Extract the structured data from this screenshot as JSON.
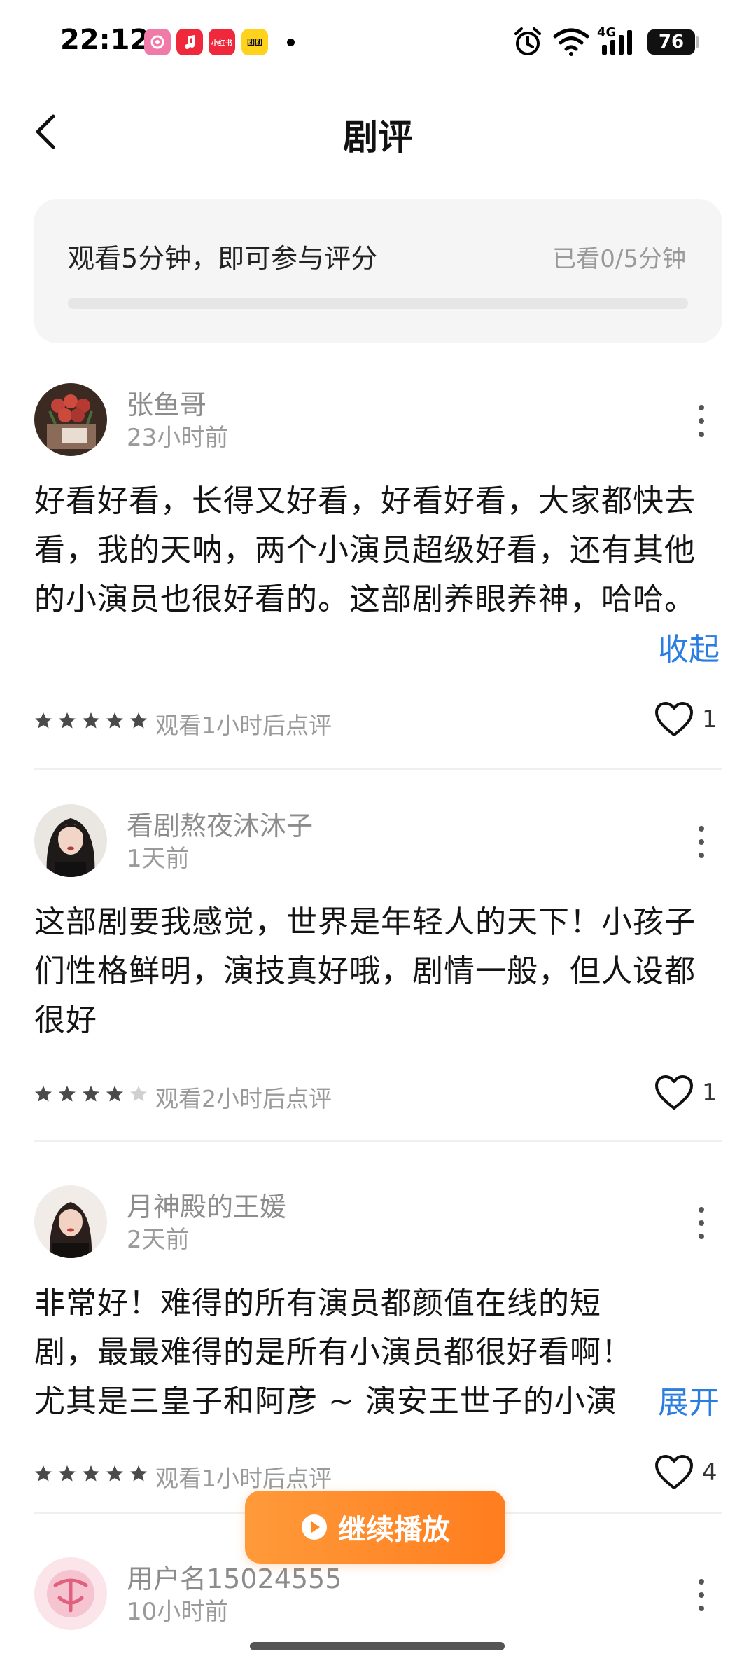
{
  "status_bar": {
    "time": "22:12",
    "apps": [
      {
        "name": "camera-app-icon",
        "color": "#f07aa8",
        "glyph": ""
      },
      {
        "name": "music-app-icon",
        "color": "#f0283c",
        "glyph": "♪"
      },
      {
        "name": "xiaohongshu-app-icon",
        "color": "#f0283c",
        "glyph": "小红书"
      },
      {
        "name": "yellow-app-icon",
        "color": "#ffd21e",
        "glyph": "团团"
      }
    ],
    "network": "4G",
    "battery": "76"
  },
  "header": {
    "title": "剧评"
  },
  "watch_card": {
    "tip": "观看5分钟，即可参与评分",
    "progress_text": "已看0/5分钟",
    "progress_fraction": 0
  },
  "reviews": [
    {
      "username": "张鱼哥",
      "time": "23小时前",
      "content": "好看好看，长得又好看，好看好看，大家都快去看，我的天呐，两个小演员超级好看，还有其他的小演员也很好看的。这部剧养眼养神，哈哈。",
      "toggle": "收起",
      "rating": 5,
      "watch_note": "观看1小时后点评",
      "likes": "1"
    },
    {
      "username": "看剧熬夜沐沐子",
      "time": "1天前",
      "content": "这部剧要我感觉，世界是年轻人的天下！小孩子们性格鲜明，演技真好哦，剧情一般，但人设都很好",
      "toggle": "",
      "rating": 4,
      "watch_note": "观看2小时后点评",
      "likes": "1"
    },
    {
      "username": "月神殿的王媛",
      "time": "2天前",
      "content": "非常好！难得的所有演员都颜值在线的短剧，最最难得的是所有小演员都很好看啊！尤其是三皇子和阿彦 ~ 演安王世子的小演员...",
      "toggle": "展开",
      "rating": 5,
      "watch_note": "观看1小时后点评",
      "likes": "4"
    },
    {
      "username": "用户名15024555",
      "time": "10小时前"
    }
  ],
  "play_button": {
    "label": "继续播放"
  },
  "colors": {
    "accent_orange": "#ff8a1f",
    "link_blue": "#2a7de1",
    "star_filled": "#4a4a4a",
    "star_empty": "#d0d0d0"
  }
}
